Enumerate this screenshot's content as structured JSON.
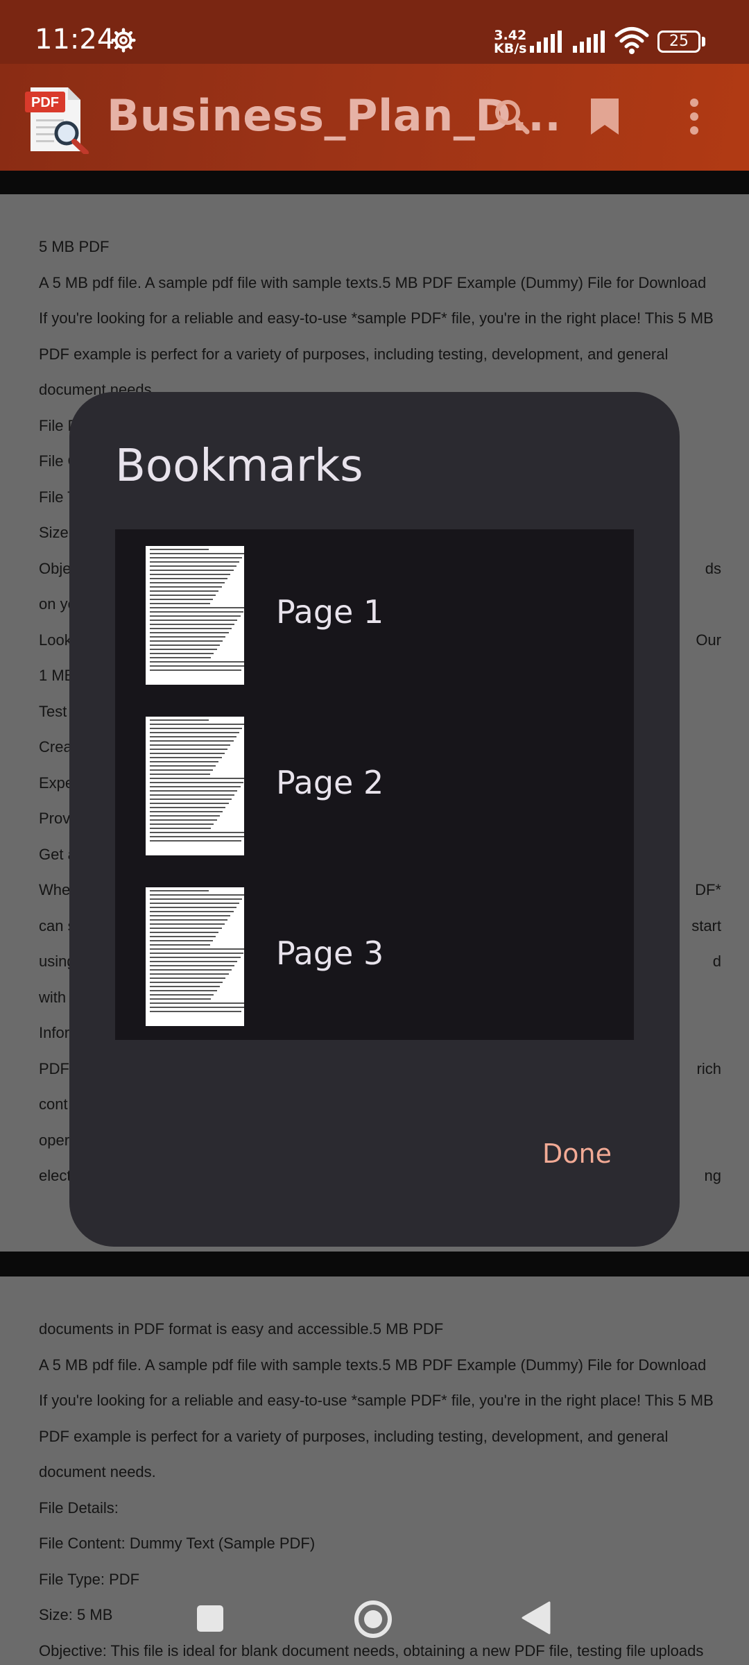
{
  "status_bar": {
    "time": "11:24",
    "speed_value": "3.42",
    "speed_unit": "KB/s",
    "battery": "25"
  },
  "app_bar": {
    "logo_text": "PDF",
    "title": "Business_Plan_D..."
  },
  "document": {
    "page1_lines": [
      "5 MB PDF",
      "A 5 MB pdf file. A sample pdf file with sample texts.5 MB PDF Example (Dummy) File for Download",
      "If you're looking for a reliable and easy-to-use *sample PDF* file, you're in the right place! This 5 MB",
      "PDF example is perfect for a variety of purposes, including testing, development, and general",
      "document needs.",
      "File D",
      "File C",
      "File T",
      "Size",
      "Obje",
      "on yo",
      "Look",
      "1 MB",
      "Test",
      "Crea",
      "Expe",
      "Prov",
      "Get a",
      "Whe",
      "can s",
      "using",
      "with",
      "Infor",
      "PDF",
      "cont",
      "oper",
      "elect"
    ],
    "page1_right_fragments": [
      "ds",
      "Our",
      "DF*",
      "start",
      "d",
      "rich",
      "ng"
    ],
    "page2_lines": [
      "documents in PDF format is easy and accessible.5 MB PDF",
      "A 5 MB pdf file. A sample pdf file with sample texts.5 MB PDF Example (Dummy) File for Download",
      "If you're looking for a reliable and easy-to-use *sample PDF* file, you're in the right place! This 5 MB",
      "PDF example is perfect for a variety of purposes, including testing, development, and general",
      "document needs.",
      "File Details:",
      "File Content: Dummy Text (Sample PDF)",
      "File Type: PDF",
      "Size: 5 MB",
      "Objective: This file is ideal for blank document needs, obtaining a new PDF file, testing file uploads"
    ]
  },
  "dialog": {
    "title": "Bookmarks",
    "bookmarks": [
      {
        "label": "Page 1"
      },
      {
        "label": "Page 2"
      },
      {
        "label": "Page 3"
      }
    ],
    "done_label": "Done"
  },
  "icons": {
    "settings": "gear-icon",
    "signal": "signal-icon",
    "wifi": "wifi-icon",
    "battery": "battery-icon",
    "search": "search-icon",
    "bookmark": "bookmark-icon",
    "menu": "more-vert-icon",
    "nav_recents": "recents-icon",
    "nav_home": "home-icon",
    "nav_back": "back-icon"
  }
}
